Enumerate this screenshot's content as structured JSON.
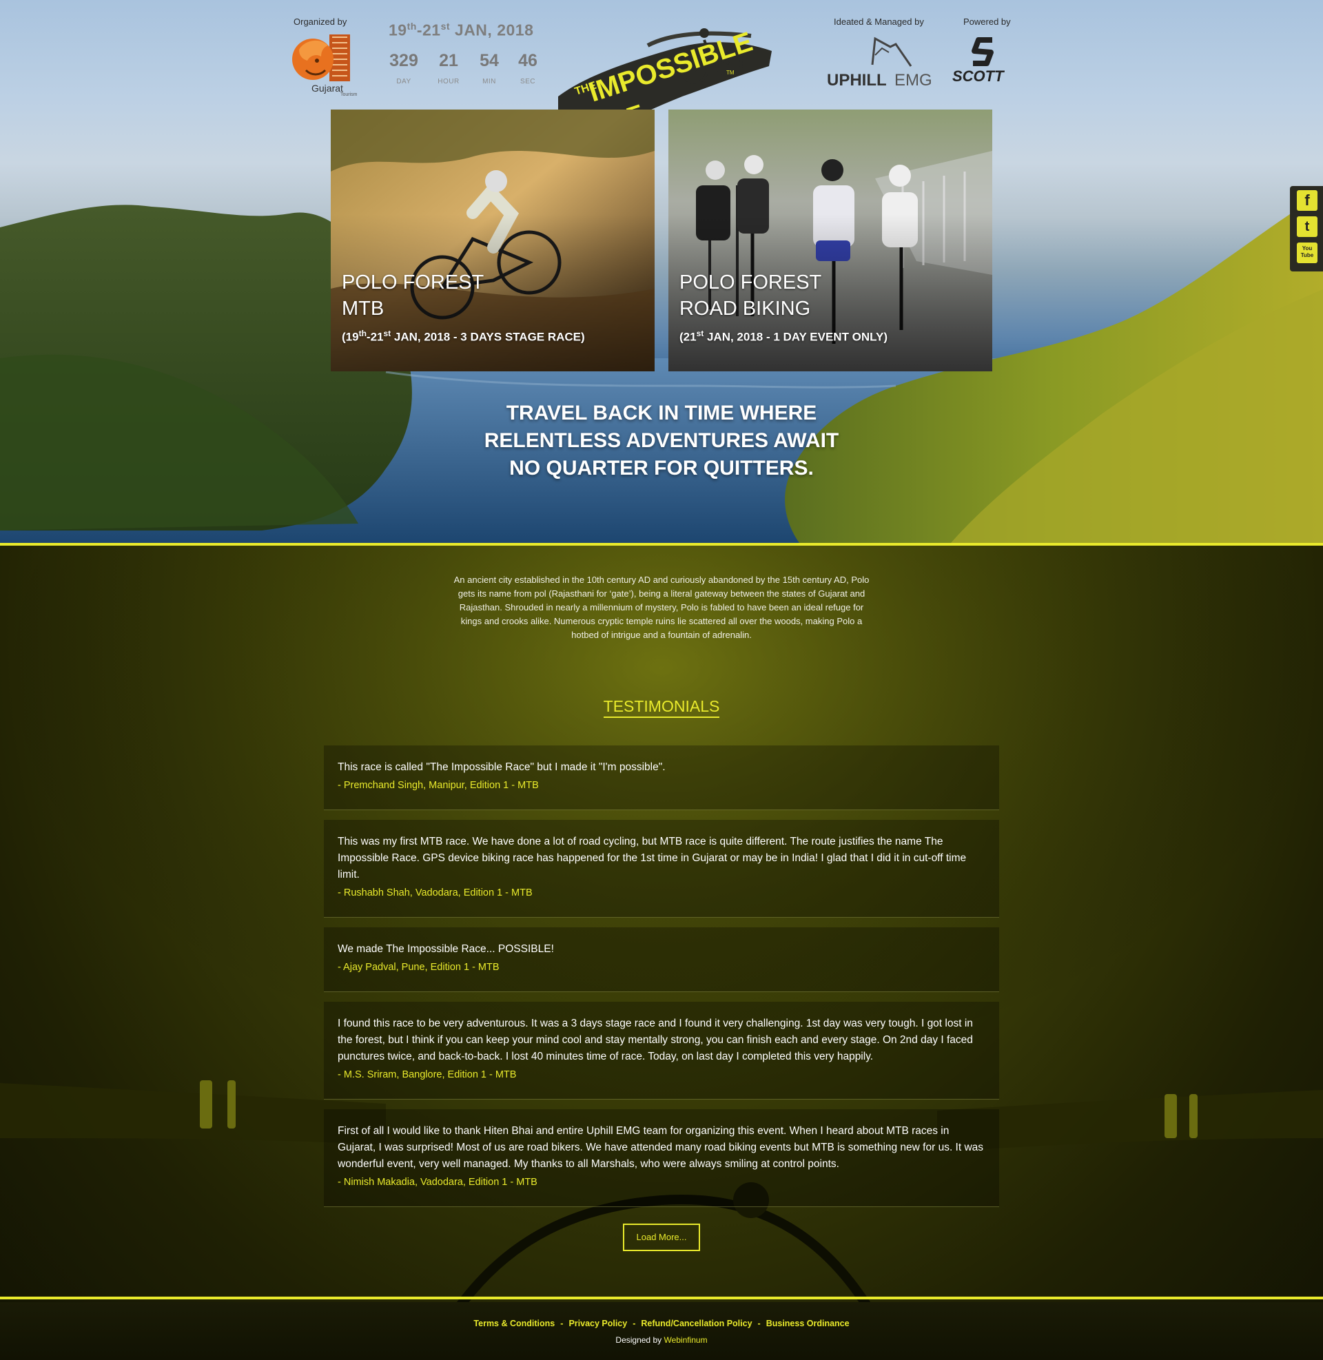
{
  "header": {
    "organized_label": "Organized by",
    "organizer_name": "Gujarat",
    "organizer_sub": "Tourism",
    "date_day_start": "19",
    "date_day_start_suffix": "th",
    "date_dash": "-21",
    "date_day_end_suffix": "st",
    "date_rest": " JAN, 2018",
    "countdown": {
      "day": "329",
      "day_label": "DAY",
      "hour": "21",
      "hour_label": "HOUR",
      "min": "54",
      "min_label": "MIN",
      "sec": "46",
      "sec_label": "SEC"
    },
    "race_logo_the": "THE",
    "race_logo_word1": "IMPOSSIBLE",
    "race_logo_word2": "RACE",
    "race_logo_tm": "TM",
    "managed_label": "Ideated & Managed by",
    "managed_name_bold": "UPHILL",
    "managed_name_light": "EMG",
    "powered_label": "Powered by",
    "powered_name": "SCOTT"
  },
  "cards": [
    {
      "title_line1": "POLO FOREST",
      "title_line2": "MTB",
      "sub_open": "(19",
      "sub_sup1": "th",
      "sub_mid": "-21",
      "sub_sup2": "st",
      "sub_rest": " JAN, 2018 - 3 DAYS STAGE RACE)"
    },
    {
      "title_line1": "POLO FOREST",
      "title_line2": "ROAD BIKING",
      "sub_open": "(21",
      "sub_sup1": "st",
      "sub_rest": " JAN, 2018 - 1 DAY EVENT ONLY)"
    }
  ],
  "tagline": {
    "line1": "TRAVEL BACK IN TIME WHERE",
    "line2": "RELENTLESS ADVENTURES AWAIT",
    "line3": "NO QUARTER FOR QUITTERS."
  },
  "social": {
    "facebook": "f",
    "twitter": "t",
    "youtube": "You Tube",
    "icons": [
      "facebook-icon",
      "twitter-icon",
      "youtube-icon"
    ]
  },
  "intro": "An ancient city established in the 10th century AD and curiously abandoned by the 15th century AD, Polo gets its name from pol (Rajasthani for ‘gate’), being a literal gateway between the states of Gujarat and Rajasthan. Shrouded in nearly a millennium of mystery, Polo is fabled to have been an ideal refuge for kings and crooks alike. Numerous cryptic temple ruins lie scattered all over the woods, making Polo a hotbed of intrigue and a fountain of adrenalin.",
  "testimonials": {
    "heading": "TESTIMONIALS",
    "items": [
      {
        "quote": "This race is called \"The Impossible Race\" but I made it \"I'm possible\".",
        "author": "- Premchand Singh, Manipur, Edition 1 - MTB"
      },
      {
        "quote": "This was my first MTB race. We have done a lot of road cycling, but MTB race is quite different. The route justifies the name The Impossible Race. GPS device biking race has happened for the 1st time in Gujarat or may be in India! I glad that I did it in cut-off time limit.",
        "author": "- Rushabh Shah, Vadodara, Edition 1 - MTB"
      },
      {
        "quote": "We made The Impossible Race... POSSIBLE!",
        "author": "- Ajay Padval, Pune, Edition 1 - MTB"
      },
      {
        "quote": "I found this race to be very adventurous. It was a 3 days stage race and I found it very challenging. 1st day was very tough. I got lost in the forest, but I think if you can keep your mind cool and stay mentally strong, you can finish each and every stage. On 2nd day I faced punctures twice, and back-to-back. I lost 40 minutes time of race. Today, on last day I completed this very happily.",
        "author": "- M.S. Sriram, Banglore, Edition 1 - MTB"
      },
      {
        "quote": "First of all I would like to thank Hiten Bhai and entire Uphill EMG team for organizing this event. When I heard about MTB races in Gujarat, I was surprised! Most of us are road bikers. We have attended many road biking events but MTB is something new for us. It was wonderful event, very well managed. My thanks to all Marshals, who were always smiling at control points.",
        "author": "- Nimish Makadia, Vadodara, Edition 1 - MTB"
      }
    ],
    "load_more": "Load More..."
  },
  "footer": {
    "links": [
      "Terms & Conditions",
      "Privacy Policy",
      "Refund/Cancellation Policy",
      "Business Ordinance"
    ],
    "separator": "-",
    "credit_prefix": "Designed by ",
    "credit_name": "Webinfinum"
  },
  "colors": {
    "accent": "#e9ea2c",
    "countdown": "#787878",
    "logo_orange": "#e8711f"
  }
}
